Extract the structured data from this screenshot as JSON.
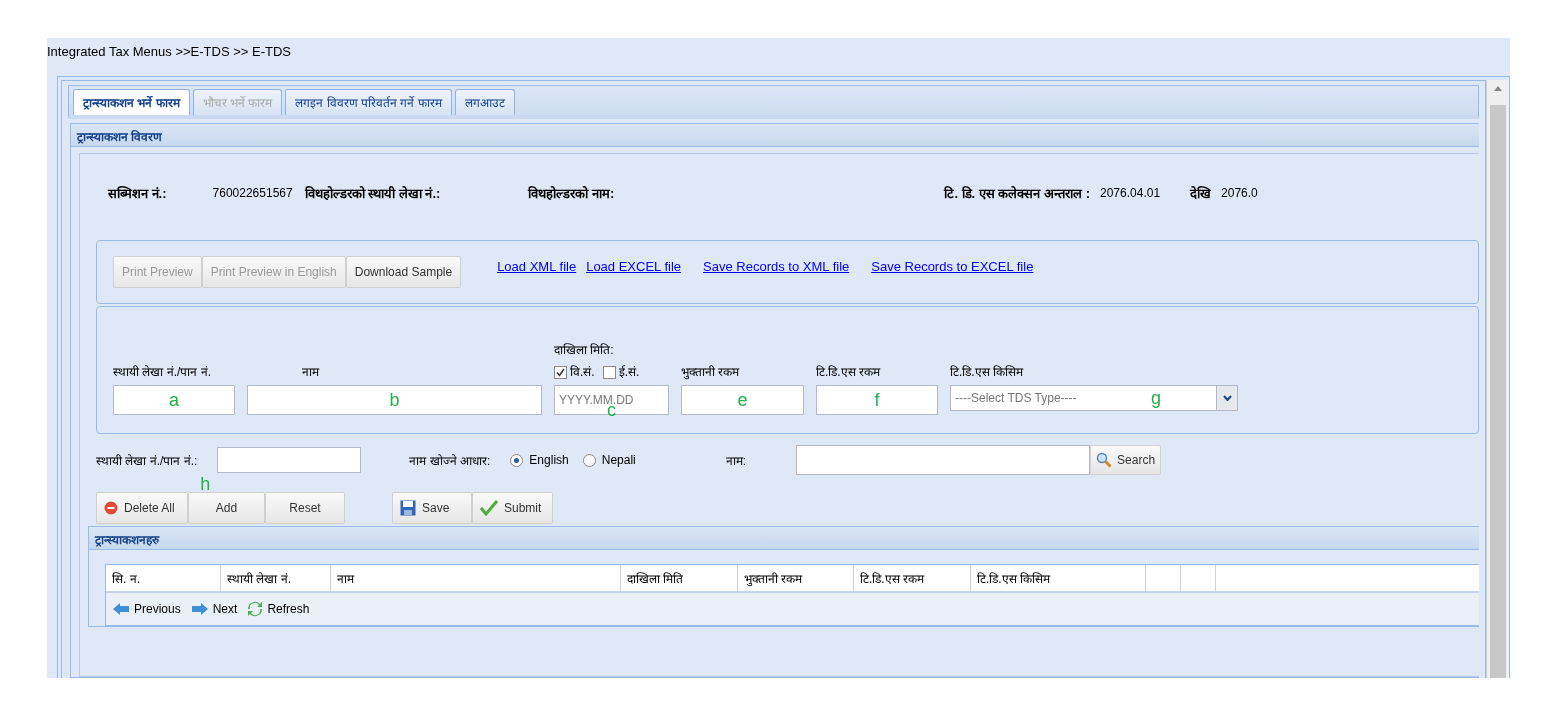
{
  "breadcrumb": "Integrated Tax Menus >>E-TDS >> E-TDS",
  "tabs": [
    {
      "label": "ट्रान्स्याकशन भर्ने फारम",
      "selected": true,
      "disabled": false
    },
    {
      "label": "भौचर भर्ने फारम",
      "selected": false,
      "disabled": true
    },
    {
      "label": "लगइन विवरण परिवर्तन गर्ने फारम",
      "selected": false,
      "disabled": false
    },
    {
      "label": "लगआउट",
      "selected": false,
      "disabled": false
    }
  ],
  "details_panel": {
    "title": "ट्रान्स्याकशन विवरण",
    "info": [
      {
        "label": "सब्मिशन नं.:",
        "value": "760022651567"
      },
      {
        "label": "विथहोल्डरको स्थायी लेखा नं.:"
      },
      {
        "label": "विथहोल्डरको नाम:"
      },
      {
        "label": "टि. डि. एस कलेक्सन अन्तराल :",
        "value": "2076.04.01"
      },
      {
        "label": "देखि",
        "value": "2076.0"
      }
    ],
    "toolbar_buttons": [
      {
        "label": "Print Preview",
        "disabled": true
      },
      {
        "label": "Print Preview in English",
        "disabled": true
      },
      {
        "label": "Download Sample",
        "disabled": false
      }
    ],
    "links": [
      "Load XML file",
      "Load EXCEL file",
      "Save Records to XML file",
      "Save Records to EXCEL file"
    ],
    "date_label": "दाखिला मिति:",
    "date_systems": [
      {
        "label": "वि.सं.",
        "checked": true
      },
      {
        "label": "ई.सं.",
        "checked": false
      }
    ],
    "fields": [
      {
        "kind": "text",
        "label": "स्थायी लेखा नं./पान नं.",
        "annotation": "a"
      },
      {
        "kind": "text",
        "label": "नाम",
        "annotation": "b"
      },
      {
        "kind": "date",
        "placeholder": "YYYY.MM.DD",
        "annotation": "c"
      },
      {
        "kind": "text",
        "label": "भुक्तानी रकम",
        "annotation": "e"
      },
      {
        "kind": "text",
        "label": "टि.डि.एस रकम",
        "annotation": "f"
      },
      {
        "kind": "select",
        "label": "टि.डि.एस किसिम",
        "value": "----Select TDS Type----",
        "annotation": "g"
      }
    ],
    "search": {
      "pan_label": "स्थायी लेखा नं./पान नं.:",
      "pan_annotation": "h",
      "basis_label": "नाम खोज्ने आधार:",
      "options": [
        {
          "label": "English",
          "selected": true
        },
        {
          "label": "Nepali",
          "selected": false
        }
      ],
      "name_label": "नाम:",
      "button": "Search"
    },
    "actions": [
      {
        "kind": "delete",
        "label": "Delete All"
      },
      {
        "kind": "plain",
        "label": "Add"
      },
      {
        "kind": "plain",
        "label": "Reset"
      },
      {
        "kind": "save",
        "label": "Save"
      },
      {
        "kind": "submit",
        "label": "Submit"
      }
    ]
  },
  "transactions_panel": {
    "title": "ट्रान्स्याकशनहरु",
    "columns": [
      "सि. न.",
      "स्थायी लेखा नं.",
      "नाम",
      "दाखिला मिति",
      "भुक्तानी रकम",
      "टि.डि.एस रकम",
      "टि.डि.एस किसिम",
      "",
      ""
    ],
    "pager": [
      {
        "kind": "previous",
        "label": "Previous"
      },
      {
        "kind": "next",
        "label": "Next"
      },
      {
        "kind": "refresh",
        "label": "Refresh"
      }
    ]
  }
}
